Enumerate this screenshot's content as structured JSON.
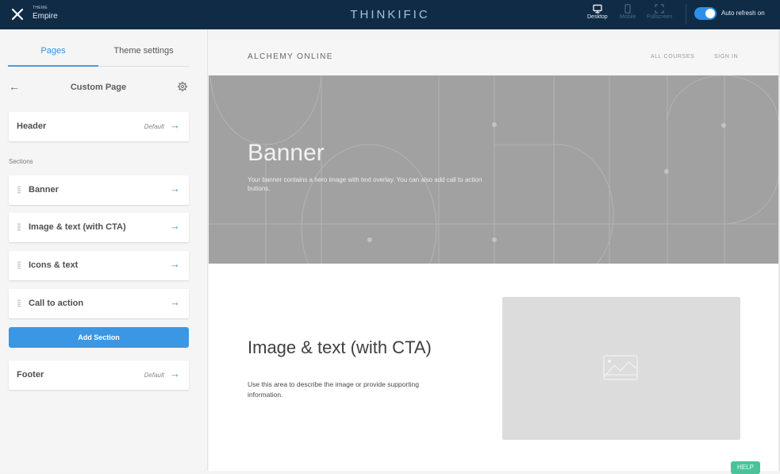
{
  "topbar": {
    "close_icon": "close-icon",
    "theme_label": "THEME",
    "theme_name": "Empire",
    "brand": "THINKIFIC",
    "devices": [
      {
        "label": "Desktop",
        "icon": "desktop-icon",
        "active": true
      },
      {
        "label": "Mobile",
        "icon": "mobile-icon",
        "active": false
      },
      {
        "label": "Fullscreen",
        "icon": "fullscreen-icon",
        "active": false
      }
    ],
    "auto_refresh": {
      "label": "Auto refresh on",
      "on": true
    }
  },
  "sidebar": {
    "tabs": [
      {
        "label": "Pages",
        "active": true
      },
      {
        "label": "Theme settings",
        "active": false
      }
    ],
    "page_title": "Custom Page",
    "header_card": {
      "label": "Header",
      "badge": "Default"
    },
    "sections_label": "Sections",
    "sections": [
      {
        "label": "Banner"
      },
      {
        "label": "Image & text (with CTA)"
      },
      {
        "label": "Icons & text"
      },
      {
        "label": "Call to action"
      }
    ],
    "add_section_label": "Add Section",
    "footer_card": {
      "label": "Footer",
      "badge": "Default"
    }
  },
  "preview": {
    "site_name": "ALCHEMY ONLINE",
    "nav": [
      "ALL COURSES",
      "SIGN IN"
    ],
    "banner": {
      "title": "Banner",
      "text": "Your banner contains a hero image with text overlay. You can also add call to action buttons."
    },
    "image_text": {
      "title": "Image & text (with CTA)",
      "text": "Use this area to describe the image or provide supporting information."
    },
    "help_label": "HELP"
  },
  "colors": {
    "topbar_bg": "#0f2b46",
    "accent": "#3b97e3",
    "help": "#48c39a",
    "banner_bg": "#a1a1a1"
  }
}
